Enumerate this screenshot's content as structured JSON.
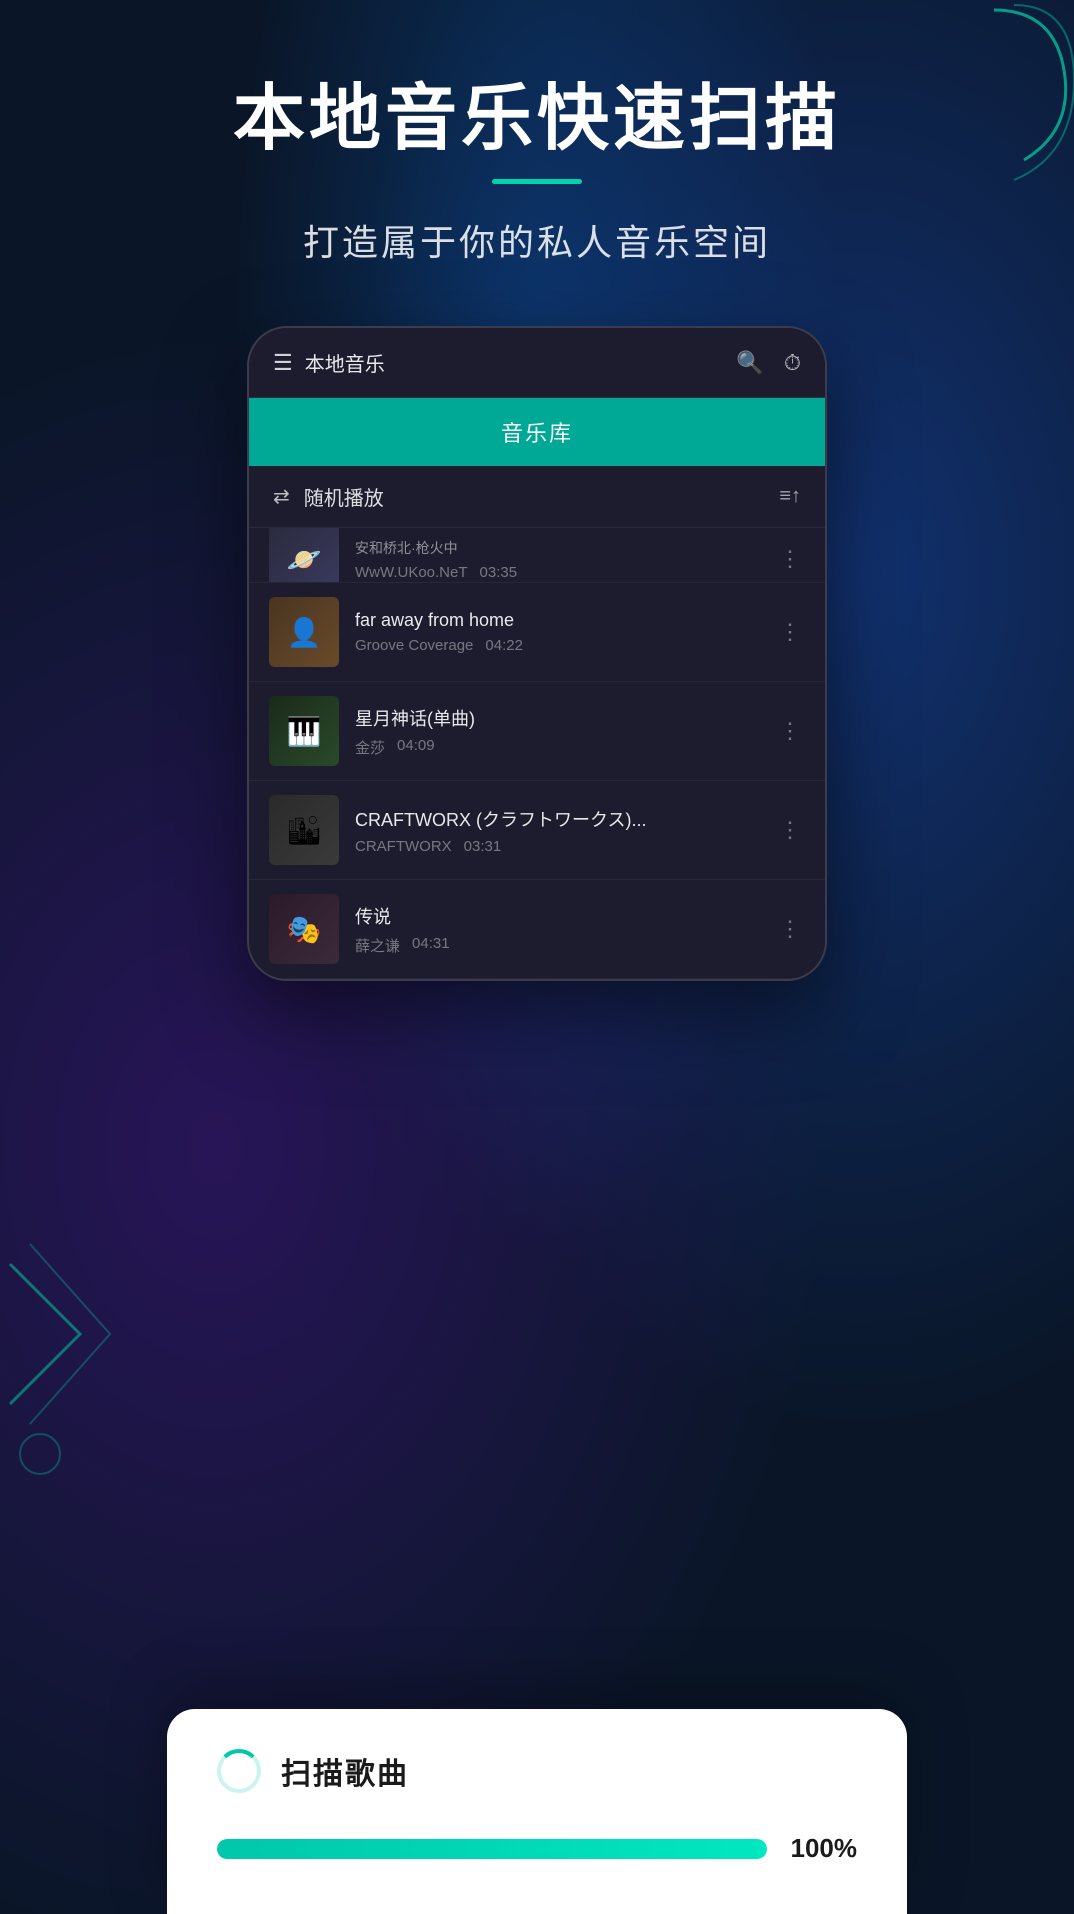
{
  "background": {
    "color": "#0a1628"
  },
  "header": {
    "main_title": "本地音乐快速扫描",
    "sub_title": "打造属于你的私人音乐空间",
    "title_underline_color": "#00d4aa"
  },
  "app": {
    "header_title": "本地音乐",
    "music_library_tab": "音乐库",
    "shuffle_label": "随机播放"
  },
  "songs": [
    {
      "title": "安和桥北·枪火中",
      "artist": "WwW.UKoo.NeT",
      "duration": "03:35",
      "art_class": "art-1",
      "art_icon": "🪐"
    },
    {
      "title": "far away from home",
      "artist": "Groove Coverage",
      "duration": "04:22",
      "art_class": "art-2",
      "art_icon": "👤"
    },
    {
      "title": "星月神话(单曲)",
      "artist": "金莎",
      "duration": "04:09",
      "art_class": "art-3",
      "art_icon": "🎹"
    },
    {
      "title": "CRAFTWORX (クラフトワークス)...",
      "artist": "CRAFTWORX",
      "duration": "03:31",
      "art_class": "art-4",
      "art_icon": "🏙"
    },
    {
      "title": "传说",
      "artist": "薛之谦",
      "duration": "04:31",
      "art_class": "art-5",
      "art_icon": "🎭"
    }
  ],
  "scan_dialog": {
    "title": "扫描歌曲",
    "progress_percent": 100,
    "progress_label": "100%"
  }
}
